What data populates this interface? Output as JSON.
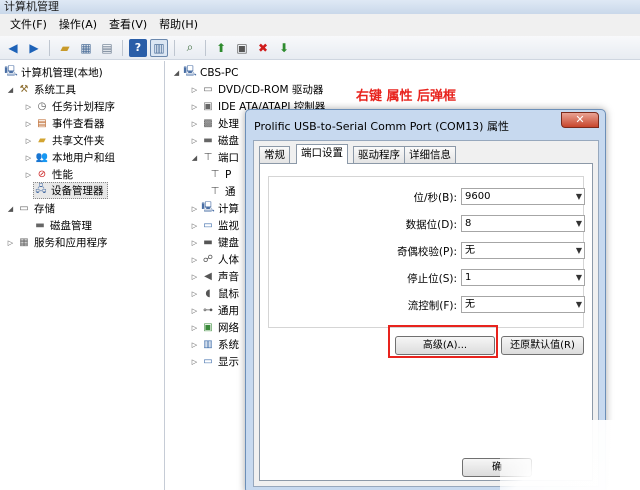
{
  "window": {
    "title": "计算机管理"
  },
  "menu": [
    "文件(F)",
    "操作(A)",
    "查看(V)",
    "帮助(H)"
  ],
  "toolbar_icons": [
    "back-arrow-icon",
    "forward-arrow-icon",
    "up-folder-icon",
    "show-hide-tree-icon",
    "properties-icon",
    "help-icon",
    "console-view-icon",
    "scan-hardware-icon",
    "update-driver-icon",
    "disable-device-icon",
    "uninstall-device-icon"
  ],
  "tree": {
    "root": "计算机管理(本地)",
    "system_tools": "系统工具",
    "task_scheduler": "任务计划程序",
    "event_viewer": "事件查看器",
    "shared_folders": "共享文件夹",
    "local_users": "本地用户和组",
    "performance": "性能",
    "device_manager": "设备管理器",
    "storage": "存储",
    "disk_management": "磁盘管理",
    "services_apps": "服务和应用程序"
  },
  "devices": {
    "computer": "CBS-PC",
    "dvd": "DVD/CD-ROM 驱动器",
    "ide": "IDE ATA/ATAPI 控制器",
    "processor": "处理",
    "disk": "磁盘",
    "ports": "端口",
    "port_child_1": "P",
    "port_child_2": "通",
    "computer_cat": "计算",
    "monitor": "监视",
    "keyboard": "键盘",
    "hid": "人体",
    "sound": "声音",
    "mouse": "鼠标",
    "usb": "通用",
    "network": "网络",
    "system": "系统",
    "display": "显示"
  },
  "annotation": "右键 属性 后弹框",
  "dialog": {
    "title": "Prolific USB-to-Serial Comm Port (COM13) 属性",
    "close": "✕",
    "tabs": [
      "常规",
      "端口设置",
      "驱动程序",
      "详细信息"
    ],
    "fields": [
      {
        "label": "位/秒(B):",
        "value": "9600"
      },
      {
        "label": "数据位(D):",
        "value": "8"
      },
      {
        "label": "奇偶校验(P):",
        "value": "无"
      },
      {
        "label": "停止位(S):",
        "value": "1"
      },
      {
        "label": "流控制(F):",
        "value": "无"
      }
    ],
    "advanced_button": "高级(A)...",
    "restore_button": "还原默认值(R)",
    "ok_button": "确"
  },
  "colors": {
    "annotation": "#e8231d",
    "dialog_frame": "#c7d9ef",
    "highlight": "#e8231d"
  }
}
